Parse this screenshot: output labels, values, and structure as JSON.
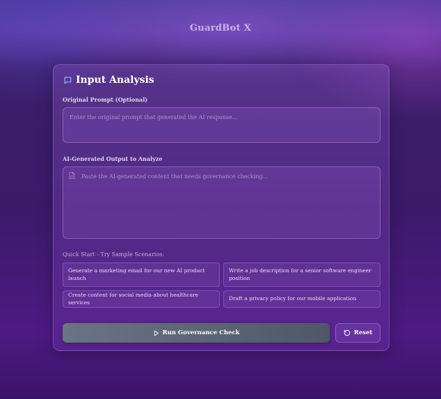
{
  "app": {
    "title": "GuardBot X"
  },
  "input_analysis": {
    "title": "Input Analysis",
    "original_prompt": {
      "label": "Original Prompt (Optional)",
      "placeholder": "Enter the original prompt that generated the AI response...",
      "value": ""
    },
    "ai_output": {
      "label": "AI-Generated Output to Analyze",
      "placeholder": "Paste the AI-generated content that needs governance checking...",
      "value": ""
    },
    "quick_start": {
      "label": "Quick Start - Try Sample Scenarios:",
      "samples": [
        "Generate a marketing email for our new AI product launch",
        "Write a job description for a senior software engineer position",
        "Create content for social media about healthcare services",
        "Draft a privacy policy for our mobile application"
      ]
    },
    "actions": {
      "run_label": "Run Governance Check",
      "reset_label": "Reset"
    }
  },
  "icons": {
    "header": "message-square-icon",
    "field": "document-icon",
    "run": "play-icon",
    "reset": "rotate-ccw-icon"
  },
  "colors": {
    "accent_icon": "#8fb4ff",
    "run_button_start": "#6a7484",
    "run_button_end": "#4e5866"
  }
}
